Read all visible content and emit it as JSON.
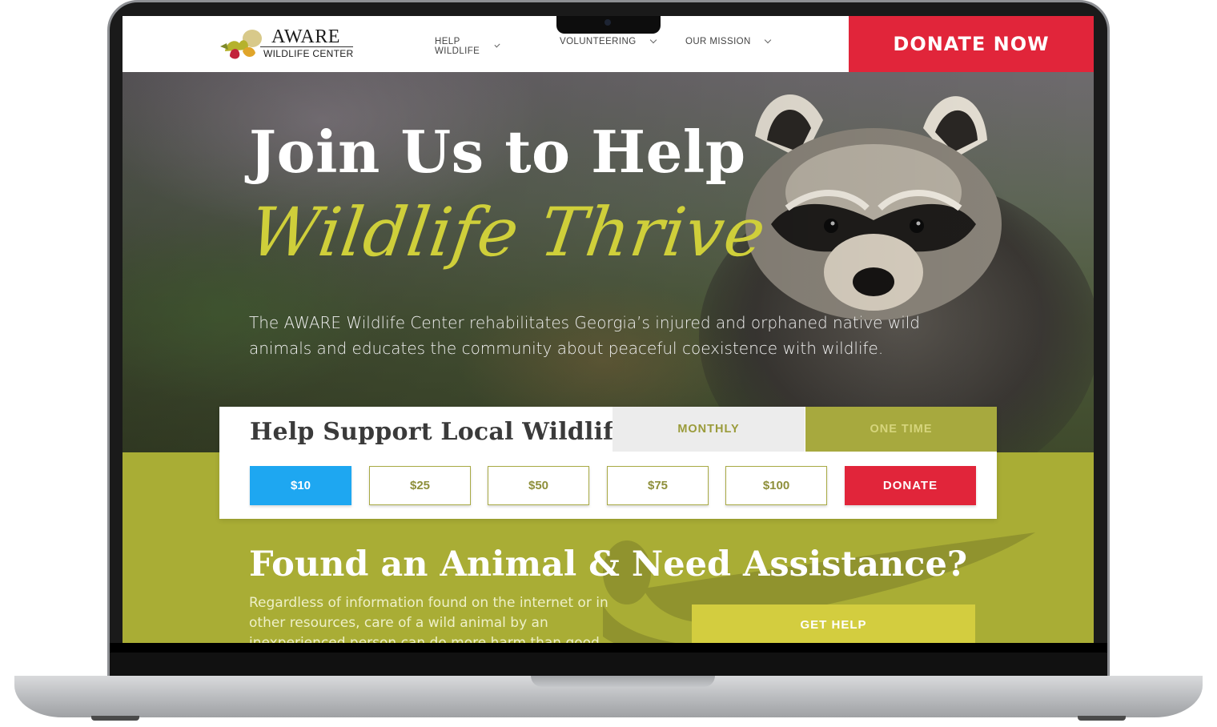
{
  "header": {
    "logo_title": "AWARE",
    "logo_subtitle": "WILDLIFE CENTER",
    "nav": [
      {
        "label": "HELP WILDLIFE"
      },
      {
        "label": "VOLUNTEERING"
      },
      {
        "label": "OUR MISSION"
      }
    ],
    "donate_now_label": "DONATE NOW",
    "colors": {
      "donate": "#e1253a"
    }
  },
  "hero": {
    "title": "Join Us to Help",
    "script_title": "Wildlife Thrive",
    "description": "The AWARE Wildlife Center rehabilitates Georgia’s injured and orphaned native wild animals and educates the community about peaceful coexistence with wildlife."
  },
  "donation": {
    "title": "Help Support Local Wildlife",
    "tabs": [
      {
        "label": "MONTHLY",
        "selected": false
      },
      {
        "label": "ONE TIME",
        "selected": true
      }
    ],
    "amounts": [
      {
        "label": "$10",
        "selected": true
      },
      {
        "label": "$25",
        "selected": false
      },
      {
        "label": "$50",
        "selected": false
      },
      {
        "label": "$75",
        "selected": false
      },
      {
        "label": "$100",
        "selected": false
      }
    ],
    "donate_label": "DONATE",
    "colors": {
      "selected": "#1ea7f1",
      "accent": "#a9ad35"
    }
  },
  "assistance": {
    "title": "Found an Animal & Need Assistance?",
    "description": "Regardless of information found on the internet or in other resources, care of a wild animal by an inexperienced person can do more harm than good.",
    "button_label": "GET HELP"
  }
}
